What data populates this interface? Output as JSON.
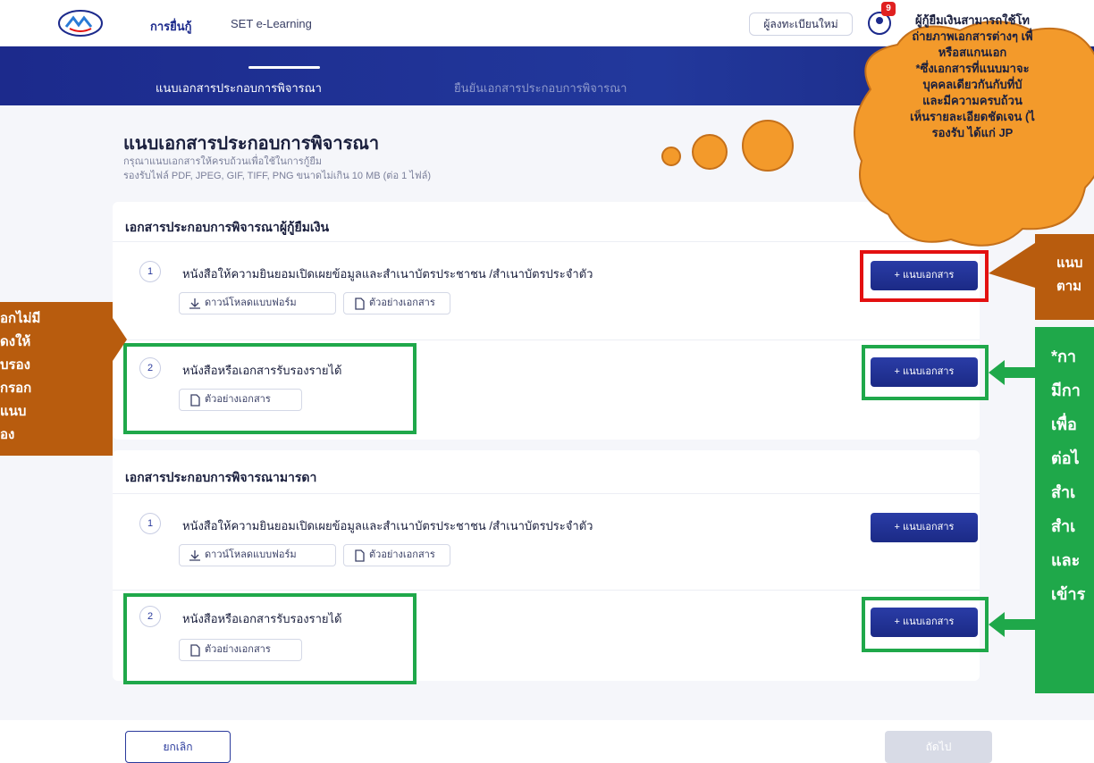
{
  "header": {
    "nav_active": "การยื่นกู้",
    "nav_elearning": "SET e-Learning",
    "register": "ผู้ลงทะเบียนใหม่",
    "notification_count": "9"
  },
  "stepper": {
    "step1": "แนบเอกสารประกอบการพิจารณา",
    "step2": "ยืนยันเอกสารประกอบการพิจารณา"
  },
  "main": {
    "heading": "แนบเอกสารประกอบการพิจารณา",
    "sub1": "กรุณาแนบเอกสารให้ครบถ้วนเพื่อใช้ในการกู้ยืม",
    "sub2": "รองรับไฟล์ PDF, JPEG, GIF, TIFF, PNG ขนาดไม่เกิน 10 MB (ต่อ 1 ไฟล์)"
  },
  "sections": [
    {
      "title": "เอกสารประกอบการพิจารณาผู้กู้ยืมเงิน",
      "items": [
        {
          "num": "1",
          "title": "หนังสือให้ความยินยอมเปิดเผยข้อมูลและสำเนาบัตรประชาชน /สำเนาบัตรประจำตัว",
          "download": "ดาวน์โหลดแบบฟอร์ม",
          "sample": "ตัวอย่างเอกสาร",
          "attach": "+ แนบเอกสาร"
        },
        {
          "num": "2",
          "title": "หนังสือหรือเอกสารรับรองรายได้",
          "sample": "ตัวอย่างเอกสาร",
          "attach": "+ แนบเอกสาร"
        }
      ]
    },
    {
      "title": "เอกสารประกอบการพิจารณามารดา",
      "items": [
        {
          "num": "1",
          "title": "หนังสือให้ความยินยอมเปิดเผยข้อมูลและสำเนาบัตรประชาชน /สำเนาบัตรประจำตัว",
          "download": "ดาวน์โหลดแบบฟอร์ม",
          "sample": "ตัวอย่างเอกสาร",
          "attach": "+ แนบเอกสาร"
        },
        {
          "num": "2",
          "title": "หนังสือหรือเอกสารรับรองรายได้",
          "sample": "ตัวอย่างเอกสาร",
          "attach": "+ แนบเอกสาร"
        }
      ]
    }
  ],
  "footer": {
    "cancel": "ยกเลิก",
    "next": "ถัดไป"
  },
  "annotations": {
    "cloud_lines": [
      "ผู้กู้ยืมเงินสามารถใช้โท",
      "ถ่ายภาพเอกสารต่างๆ เพื่",
      "หรือสแกนเอก",
      "*ซึ่งเอกสารที่แนบมาจะ",
      "บุคคลเดียวกันกับที่บั",
      "และมีความครบถ้วน",
      "เห็นรายละเอียดชัดเจน (ไ",
      "รองรับ ได้แก่ JP"
    ],
    "left_box": [
      "อกไม่มี",
      "ดงให้",
      "บรอง",
      "กรอก",
      "แนบ",
      "อง"
    ],
    "right_box": [
      "แนบ",
      "ตาม"
    ],
    "green_box": [
      "*กา",
      "มีกา",
      "เพื่อ",
      "ต่อไ",
      "สำเ",
      "สำเ",
      "และ",
      "เข้าร"
    ]
  },
  "colors": {
    "primary": "#1c2a8c",
    "highlight_red": "#e31010",
    "highlight_green": "#1fa84a",
    "callout_orange": "#f39a2b",
    "callout_brown": "#b85c0e"
  }
}
